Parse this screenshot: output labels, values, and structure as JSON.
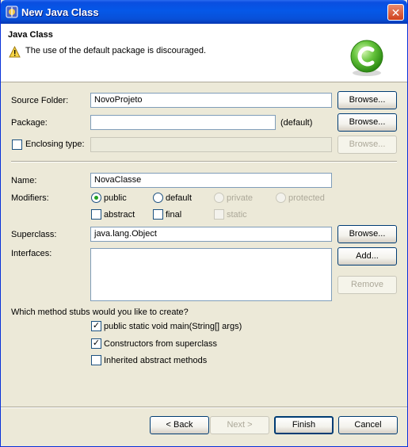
{
  "window": {
    "title": "New Java Class",
    "close_symbol": "✕",
    "icon": "java-class-icon"
  },
  "header": {
    "title": "Java Class",
    "message": "The use of the default package is discouraged.",
    "warning_icon": "warning-icon",
    "badge_icon": "java-class-badge-icon"
  },
  "form": {
    "source_folder_label": "Source Folder:",
    "source_folder_value": "NovoProjeto",
    "package_label": "Package:",
    "package_value": "",
    "package_default_hint": "(default)",
    "enclosing_type_label": "Enclosing type:",
    "enclosing_type_value": "",
    "enclosing_type_checked": false,
    "name_label": "Name:",
    "name_value": "NovaClasse",
    "modifiers_label": "Modifiers:",
    "modifiers": {
      "public": "public",
      "default": "default",
      "private": "private",
      "protected": "protected",
      "abstract": "abstract",
      "final": "final",
      "static": "static",
      "selected": "public"
    },
    "superclass_label": "Superclass:",
    "superclass_value": "java.lang.Object",
    "interfaces_label": "Interfaces:",
    "interfaces": []
  },
  "buttons": {
    "browse": "Browse...",
    "add": "Add...",
    "remove": "Remove",
    "back": "< Back",
    "next": "Next >",
    "finish": "Finish",
    "cancel": "Cancel"
  },
  "stubs": {
    "question": "Which method stubs would you like to create?",
    "main": "public static void main(String[] args)",
    "main_checked": true,
    "constructors": "Constructors from superclass",
    "constructors_checked": true,
    "inherited": "Inherited abstract methods",
    "inherited_checked": false
  },
  "colors": {
    "titlebar": "#0558e8",
    "dialog_bg": "#ece9d8",
    "check_green": "#21a121"
  }
}
